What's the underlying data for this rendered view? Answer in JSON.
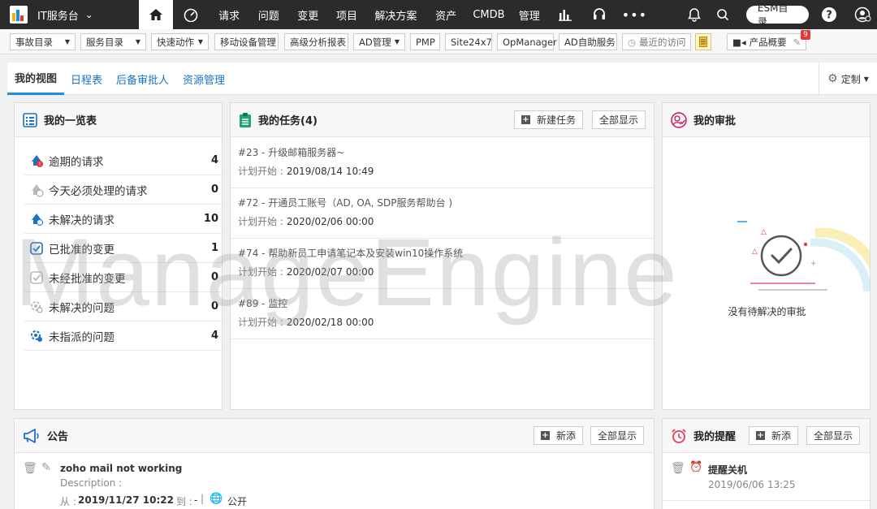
{
  "topbar": {
    "app_name": "IT服务台",
    "nav": [
      "请求",
      "问题",
      "变更",
      "项目",
      "解决方案",
      "资产",
      "CMDB",
      "管理"
    ],
    "esm_label": "ESM目录"
  },
  "toolbar": {
    "items": [
      "事故目录",
      "服务目录",
      "快速动作",
      "移动设备管理",
      "高级分析报表",
      "AD管理",
      "PMP",
      "Site24x7",
      "OpManager",
      "AD自助服务",
      "最近的访问",
      "产品概要"
    ],
    "badge": "9"
  },
  "tabs": [
    "我的视图",
    "日程表",
    "后备审批人",
    "资源管理"
  ],
  "customize_label": "定制",
  "summary": {
    "title": "我的一览表",
    "rows": [
      {
        "label": "逾期的请求",
        "count": "4"
      },
      {
        "label": "今天必须处理的请求",
        "count": "0"
      },
      {
        "label": "未解决的请求",
        "count": "10"
      },
      {
        "label": "已批准的变更",
        "count": "1"
      },
      {
        "label": "未经批准的变更",
        "count": "0"
      },
      {
        "label": "未解决的问题",
        "count": "0"
      },
      {
        "label": "未指派的问题",
        "count": "4"
      }
    ]
  },
  "tasks": {
    "title": "我的任务(4)",
    "new_label": "新建任务",
    "show_all": "全部显示",
    "date_prefix": "计划开始 :",
    "items": [
      {
        "title": "#23 - 升级邮箱服务器~",
        "date": "2019/08/14 10:49"
      },
      {
        "title": "#72 - 开通员工账号（AD, OA, SDP服务帮助台 )",
        "date": "2020/02/06 00:00"
      },
      {
        "title": "#74 - 帮助新员工申请笔记本及安装win10操作系统",
        "date": "2020/02/07 00:00"
      },
      {
        "title": "#89 - 监控",
        "date": "2020/02/18 00:00"
      }
    ]
  },
  "approvals": {
    "title": "我的审批",
    "empty_text": "没有待解决的审批"
  },
  "announcements": {
    "title": "公告",
    "new_label": "新添",
    "show_all": "全部显示",
    "item": {
      "title": "zoho mail not working",
      "description": "Description :",
      "from_label": "从 :",
      "from_date": "2019/11/27 10:22",
      "to_label": "到 :",
      "to_value": "-",
      "visibility": "公开"
    }
  },
  "reminders": {
    "title": "我的提醒",
    "new_label": "新添",
    "show_all": "全部显示",
    "item": {
      "title": "提醒关机",
      "date": "2019/06/06 13:25"
    }
  },
  "watermark": "ManageEngine"
}
